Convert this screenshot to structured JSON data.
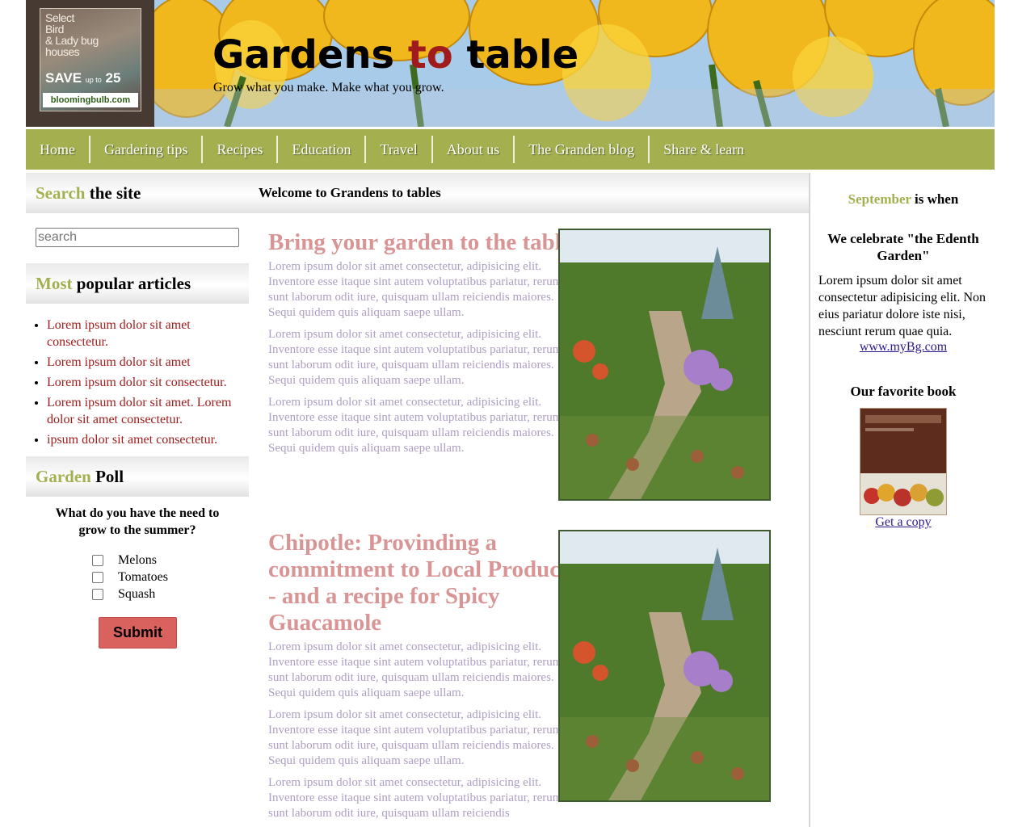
{
  "header": {
    "title_part1": "Gardens ",
    "title_accent": "to",
    "title_part2": " table",
    "tagline": "Grow what you make. Make what you grow.",
    "promo": {
      "line1": "Select",
      "line2": "Bird",
      "line3": "& Lady bug",
      "line4": "houses",
      "save": "SAVE",
      "upto": "up to",
      "amount": "25",
      "brand": "bloomingbulb.com"
    }
  },
  "nav": {
    "items": [
      "Home",
      "Gardering tips",
      "Recipes",
      "Education",
      "Travel",
      "About us",
      "The Granden blog",
      "Share & learn"
    ]
  },
  "left": {
    "search_head_accent": "Search",
    "search_head_rest": " the site",
    "search_placeholder": "search",
    "popular_head_accent": "Most",
    "popular_head_rest": " popular articles",
    "popular_items": [
      "Lorem ipsum dolor sit amet consectetur.",
      "Lorem ipsum dolor sit amet",
      "Lorem ipsum dolor sit consectetur.",
      "Lorem ipsum dolor sit amet. Lorem dolor sit amet consectetur.",
      "ipsum dolor sit amet consectetur."
    ],
    "poll_head_accent": "Garden",
    "poll_head_rest": " Poll",
    "poll_question": "What do you have the need to grow to the summer?",
    "poll_options": [
      "Melons",
      "Tomatoes",
      "Squash"
    ],
    "submit_label": "Submit"
  },
  "main": {
    "welcome": "Welcome to Grandens to tables",
    "articles": [
      {
        "title": "Bring your garden to the table",
        "paragraphs": [
          "Lorem ipsum dolor sit amet consectetur, adipisicing elit. Inventore esse itaque sint autem voluptatibus pariatur, rerum sunt laborum odit iure, quisquam ullam reiciendis maiores. Sequi quidem quis aliquam saepe ullam.",
          "Lorem ipsum dolor sit amet consectetur, adipisicing elit. Inventore esse itaque sint autem voluptatibus pariatur, rerum sunt laborum odit iure, quisquam ullam reiciendis maiores. Sequi quidem quis aliquam saepe ullam.",
          "Lorem ipsum dolor sit amet consectetur, adipisicing elit. Inventore esse itaque sint autem voluptatibus pariatur, rerum sunt laborum odit iure, quisquam ullam reiciendis maiores. Sequi quidem quis aliquam saepe ullam."
        ]
      },
      {
        "title": "Chipotle: Provinding a commitment to Local Produce - and a recipe for Spicy Guacamole",
        "paragraphs": [
          "Lorem ipsum dolor sit amet consectetur, adipisicing elit. Inventore esse itaque sint autem voluptatibus pariatur, rerum sunt laborum odit iure, quisquam ullam reiciendis maiores. Sequi quidem quis aliquam saepe ullam.",
          "Lorem ipsum dolor sit amet consectetur, adipisicing elit. Inventore esse itaque sint autem voluptatibus pariatur, rerum sunt laborum odit iure, quisquam ullam reiciendis maiores. Sequi quidem quis aliquam saepe ullam.",
          "Lorem ipsum dolor sit amet consectetur, adipisicing elit. Inventore esse itaque sint autem voluptatibus pariatur, rerum sunt laborum odit iure, quisquam ullam reiciendis"
        ]
      }
    ]
  },
  "right": {
    "head_accent": "September",
    "head_rest": " is when",
    "celebrate": "We celebrate \"the Edenth Garden\"",
    "text": "Lorem ipsum dolor sit amet consectetur adipisicing elit. Non eius pariatur dolore iste nisi, nesciunt rerum quae quia.",
    "link": "www.myBg.com",
    "book_head": "Our favorite book",
    "book_link": "Get a copy"
  },
  "colors": {
    "nav_green": "#a4b050",
    "accent_red": "#a01c1c",
    "title_pink": "#d99595",
    "body_lavender": "#ae9ec3",
    "submit_red": "#d9625f"
  }
}
